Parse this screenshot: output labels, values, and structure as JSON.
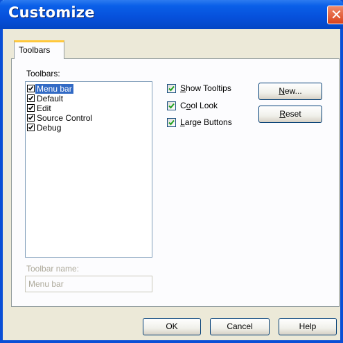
{
  "window": {
    "title": "Customize",
    "close_symbol": "✕"
  },
  "tabs": [
    {
      "label": "Toolbars"
    }
  ],
  "toolbars_label": "Toolbars:",
  "toolbar_list": [
    {
      "label": "Menu bar",
      "checked": true,
      "selected": true
    },
    {
      "label": "Default",
      "checked": true,
      "selected": false
    },
    {
      "label": "Edit",
      "checked": true,
      "selected": false
    },
    {
      "label": "Source Control",
      "checked": true,
      "selected": false
    },
    {
      "label": "Debug",
      "checked": true,
      "selected": false
    }
  ],
  "options": {
    "show_tooltips": {
      "prefix": "",
      "accel": "S",
      "rest": "how Tooltips",
      "checked": true
    },
    "cool_look": {
      "prefix": "C",
      "accel": "o",
      "rest": "ol Look",
      "checked": true
    },
    "large_buttons": {
      "prefix": "",
      "accel": "L",
      "rest": "arge Buttons",
      "checked": true
    }
  },
  "buttons": {
    "new": {
      "accel": "N",
      "rest": "ew..."
    },
    "reset": {
      "accel": "R",
      "rest": "eset"
    },
    "ok": "OK",
    "cancel": "Cancel",
    "help": "Help"
  },
  "toolbar_name": {
    "label": "Toolbar name:",
    "value": "Menu bar"
  },
  "colors": {
    "title_bar": "#0650db",
    "selection": "#316ac5",
    "dialog_bg": "#ece9d8",
    "check_green": "#21a121"
  }
}
